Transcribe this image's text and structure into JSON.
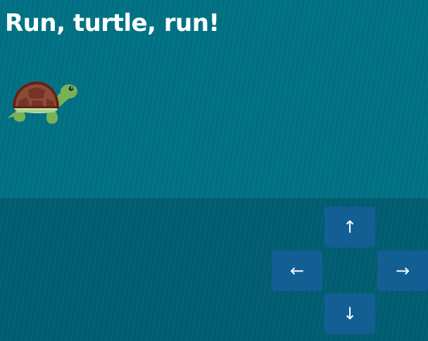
{
  "title": "Run, turtle, run!",
  "player": {
    "icon": "turtle-icon"
  },
  "controls": {
    "up_label": "↑",
    "left_label": "←",
    "right_label": "→",
    "down_label": "↓"
  },
  "colors": {
    "water": "#017185",
    "control_area": "#015e71",
    "button": "#135f93",
    "text": "#ffffff"
  }
}
